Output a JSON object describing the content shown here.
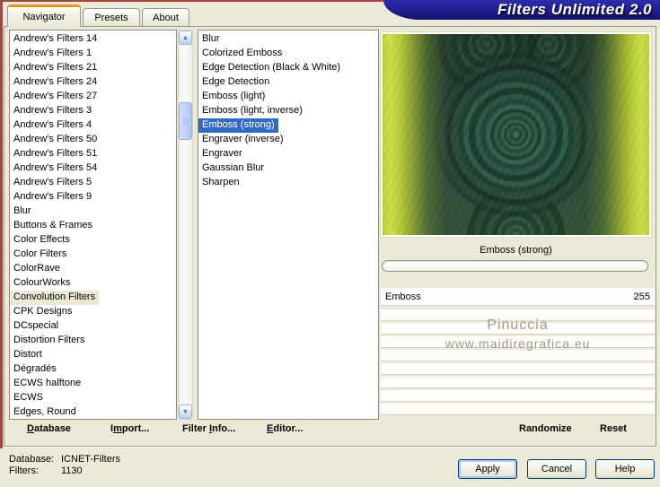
{
  "window": {
    "title": "Filters Unlimited 2.0"
  },
  "tabs": {
    "navigator": "Navigator",
    "presets": "Presets",
    "about": "About"
  },
  "categories": {
    "items": [
      "Andrew's Filters 14",
      "Andrew's Filters 1",
      "Andrew's Filters 21",
      "Andrew's Filters 24",
      "Andrew's Filters 27",
      "Andrew's Filters 3",
      "Andrew's Filters 4",
      "Andrew's Filters 50",
      "Andrew's Filters 51",
      "Andrew's Filters 54",
      "Andrew's Filters 5",
      "Andrew's Filters 9",
      "Blur",
      "Buttons & Frames",
      "Color Effects",
      "Color Filters",
      "ColorRave",
      "ColourWorks",
      "Convolution Filters",
      "CPK Designs",
      "DCspecial",
      "Distortion Filters",
      "Distort",
      "Dégradés",
      "ECWS halftone",
      "ECWS",
      "Edges, Round"
    ],
    "selected_index": 18
  },
  "filters": {
    "items": [
      "Blur",
      "Colorized Emboss",
      "Edge Detection (Black & White)",
      "Edge Detection",
      "Emboss (light)",
      "Emboss (light, inverse)",
      "Emboss (strong)",
      "Engraver (inverse)",
      "Engraver",
      "Gaussian Blur",
      "Sharpen"
    ],
    "selected_index": 6
  },
  "preview": {
    "caption": "Emboss (strong)"
  },
  "parameter": {
    "name": "Emboss",
    "value": "255"
  },
  "watermark": {
    "line1": "Pinuccia",
    "line2": "www.maidiregrafica.eu"
  },
  "toolbar": {
    "database": {
      "pre": "",
      "key": "D",
      "post": "atabase"
    },
    "import": {
      "pre": "I",
      "key": "m",
      "post": "port..."
    },
    "filter_info": {
      "pre": "Filter ",
      "key": "I",
      "post": "nfo..."
    },
    "editor": {
      "pre": "",
      "key": "E",
      "post": "ditor..."
    },
    "randomize": "Randomize",
    "reset": "Reset"
  },
  "status": {
    "database_label": "Database:",
    "database_value": "ICNET-Filters",
    "filters_label": "Filters:",
    "filters_value": "1130"
  },
  "actions": {
    "apply": "Apply",
    "cancel": "Cancel",
    "help": "Help"
  },
  "icons": {
    "scroll_up": "▲",
    "scroll_down": "▼"
  },
  "colors": {
    "banner_blue": "#1e1e8c",
    "selection_blue": "#316ac5",
    "soft_selection": "#ece8d7",
    "tab_accent_orange": "#e59527",
    "dialog_bg": "#ece9d8",
    "edge_maroon": "#9c4a41"
  }
}
